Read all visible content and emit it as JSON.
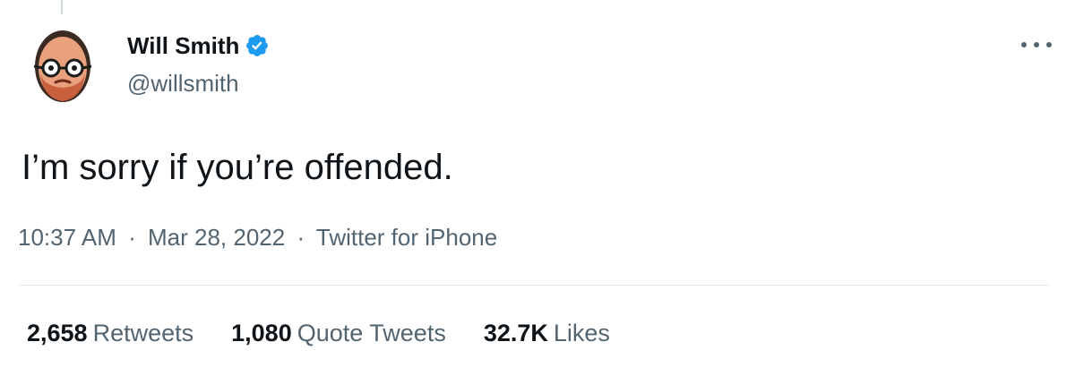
{
  "tweet": {
    "author": {
      "display_name": "Will Smith",
      "handle": "@willsmith",
      "verified": true,
      "verified_color": "#1d9bf0",
      "avatar_icon": "cartoon-face-avatar"
    },
    "more_icon": "more-horizontal-icon",
    "text": "I’m sorry if you’re offended.",
    "meta": {
      "time": "10:37 AM",
      "date": "Mar 28, 2022",
      "separator": "·",
      "source": "Twitter for iPhone"
    },
    "stats": [
      {
        "value": "2,658",
        "label": "Retweets"
      },
      {
        "value": "1,080",
        "label": "Quote Tweets"
      },
      {
        "value": "32.7K",
        "label": "Likes"
      }
    ]
  },
  "colors": {
    "text_primary": "#0f1419",
    "text_secondary": "#536471",
    "divider": "#e1e8ed"
  }
}
